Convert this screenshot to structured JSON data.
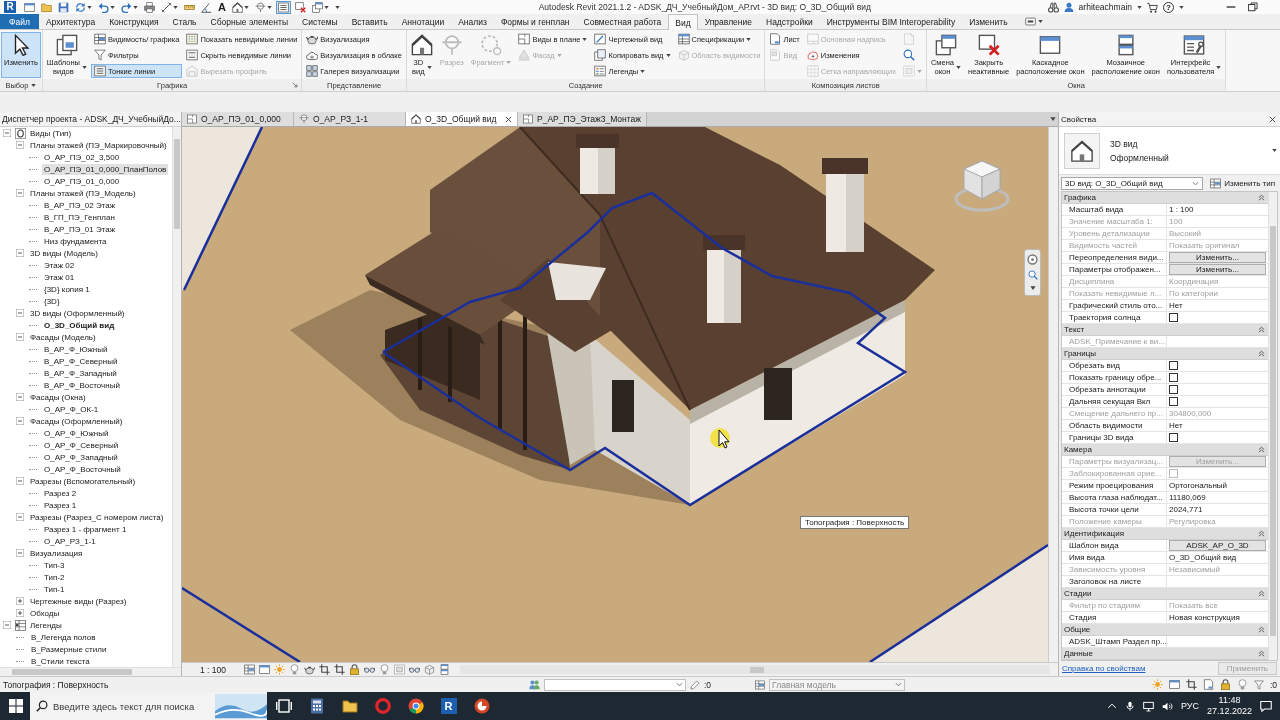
{
  "title_bar": {
    "logo": "R",
    "quick_access": [
      {
        "dropdown": false,
        "selected": false
      },
      {
        "dropdown": false,
        "selected": false
      },
      {
        "dropdown": false,
        "selected": false
      },
      {
        "dropdown": true,
        "selected": false
      },
      {
        "dropdown": true,
        "selected": false
      },
      {
        "dropdown": true,
        "selected": false
      },
      {
        "dropdown": false,
        "selected": false
      },
      {
        "dropdown": true,
        "selected": false
      },
      {
        "dropdown": false,
        "selected": false
      },
      {
        "dropdown": false,
        "selected": false
      },
      {
        "label": "A",
        "dropdown": false,
        "selected": false
      },
      {
        "dropdown": true,
        "selected": false
      },
      {
        "dropdown": true,
        "selected": false
      },
      {
        "dropdown": false,
        "selected": true
      },
      {
        "dropdown": false,
        "selected": false
      },
      {
        "dropdown": true,
        "selected": false
      },
      {
        "dropdown": true,
        "selected": false
      }
    ],
    "title": "Autodesk Revit 2021.1.2 - ADSK_ДЧ_УчебныйДом_АР.rvt - 3D вид: О_3D_Общий вид",
    "user": "arhiteachmain",
    "help": "?"
  },
  "ribbon": {
    "tabs": [
      {
        "label": "Файл",
        "kind": "file",
        "selected": false
      },
      {
        "label": "Архитектура",
        "kind": "tab",
        "selected": false
      },
      {
        "label": "Конструкция",
        "kind": "tab",
        "selected": false
      },
      {
        "label": "Сталь",
        "kind": "tab",
        "selected": false
      },
      {
        "label": "Сборные элементы",
        "kind": "tab",
        "selected": false
      },
      {
        "label": "Системы",
        "kind": "tab",
        "selected": false
      },
      {
        "label": "Вставить",
        "kind": "tab",
        "selected": false
      },
      {
        "label": "Аннотации",
        "kind": "tab",
        "selected": false
      },
      {
        "label": "Анализ",
        "kind": "tab",
        "selected": false
      },
      {
        "label": "Формы и генплан",
        "kind": "tab",
        "selected": false
      },
      {
        "label": "Совместная работа",
        "kind": "tab",
        "selected": false
      },
      {
        "label": "Вид",
        "kind": "tab",
        "selected": true
      },
      {
        "label": "Управление",
        "kind": "tab",
        "selected": false
      },
      {
        "label": "Надстройки",
        "kind": "tab",
        "selected": false
      },
      {
        "label": "Инструменты BIM Interoperability",
        "kind": "tab",
        "selected": false
      },
      {
        "label": "Изменить",
        "kind": "tab",
        "selected": false
      }
    ],
    "panels": [
      {
        "title": "Выбор",
        "menu": true,
        "launcher": false,
        "groups": [
          {
            "kind": "large",
            "buttons": [
              {
                "label": "Изменить",
                "selected": true,
                "disabled": false,
                "dropdown": false
              }
            ]
          }
        ]
      },
      {
        "title": "Графика",
        "menu": false,
        "launcher": true,
        "groups": [
          {
            "kind": "large",
            "buttons": [
              {
                "label": "Шаблоны\nвидов",
                "selected": false,
                "disabled": false,
                "dropdown": true
              }
            ]
          },
          {
            "kind": "column",
            "buttons": [
              {
                "label": "Видимость/ графика",
                "selected": false,
                "disabled": false,
                "dropdown": false
              },
              {
                "label": "Фильтры",
                "selected": false,
                "disabled": false,
                "dropdown": false
              },
              {
                "label": "Тонкие линии",
                "selected": true,
                "disabled": false,
                "dropdown": false
              }
            ]
          },
          {
            "kind": "column",
            "buttons": [
              {
                "label": "Показать невидимые линии",
                "selected": false,
                "disabled": false,
                "dropdown": false
              },
              {
                "label": "Скрыть невидимые линии",
                "selected": false,
                "disabled": false,
                "dropdown": false
              },
              {
                "label": "Вырезать профиль",
                "selected": false,
                "disabled": true,
                "dropdown": false
              }
            ]
          }
        ]
      },
      {
        "title": "Представление",
        "menu": false,
        "launcher": false,
        "groups": [
          {
            "kind": "column",
            "buttons": [
              {
                "label": "Визуализация",
                "selected": false,
                "disabled": false,
                "dropdown": false
              },
              {
                "label": "Визуализация в облаке",
                "selected": false,
                "disabled": false,
                "dropdown": false
              },
              {
                "label": "Галерея визуализации",
                "selected": false,
                "disabled": false,
                "dropdown": false
              }
            ]
          }
        ]
      },
      {
        "title": "Создание",
        "menu": false,
        "launcher": false,
        "groups": [
          {
            "kind": "large",
            "buttons": [
              {
                "label": "3D\nвид",
                "selected": false,
                "disabled": false,
                "dropdown": true
              },
              {
                "label": "Разрез",
                "selected": false,
                "disabled": true,
                "dropdown": false
              },
              {
                "label": "Фрагмент",
                "selected": false,
                "disabled": true,
                "dropdown": true
              }
            ]
          },
          {
            "kind": "column",
            "buttons": [
              {
                "label": "Виды в плане",
                "selected": false,
                "disabled": false,
                "dropdown": true
              },
              {
                "label": "Фасад",
                "selected": false,
                "disabled": true,
                "dropdown": true
              }
            ]
          },
          {
            "kind": "column",
            "buttons": [
              {
                "label": "Чертежный вид",
                "selected": false,
                "disabled": false,
                "dropdown": false
              },
              {
                "label": "Копировать вид",
                "selected": false,
                "disabled": false,
                "dropdown": true
              },
              {
                "label": "Легенды",
                "selected": false,
                "disabled": false,
                "dropdown": true
              }
            ]
          },
          {
            "kind": "column",
            "buttons": [
              {
                "label": "Спецификации",
                "selected": false,
                "disabled": false,
                "dropdown": true
              },
              {
                "label": "Область видимости",
                "selected": false,
                "disabled": true,
                "dropdown": false
              }
            ]
          }
        ]
      },
      {
        "title": "Композиция листов",
        "menu": false,
        "launcher": false,
        "groups": [
          {
            "kind": "column",
            "buttons": [
              {
                "label": "Лист",
                "selected": false,
                "disabled": false,
                "dropdown": false
              },
              {
                "label": "Вид",
                "selected": false,
                "disabled": true,
                "dropdown": false
              }
            ]
          },
          {
            "kind": "column",
            "buttons": [
              {
                "label": "Основная надпись",
                "selected": false,
                "disabled": true,
                "dropdown": false
              },
              {
                "label": "Изменения",
                "selected": false,
                "disabled": false,
                "dropdown": false
              },
              {
                "label": "Сетка направляющих",
                "selected": false,
                "disabled": true,
                "dropdown": false
              }
            ]
          },
          {
            "kind": "column",
            "buttons": [
              {
                "selected": false,
                "disabled": true,
                "dropdown": false
              },
              {
                "selected": false,
                "disabled": false,
                "dropdown": false
              },
              {
                "selected": false,
                "disabled": true,
                "dropdown": true
              }
            ]
          }
        ]
      },
      {
        "title": "Окна",
        "menu": false,
        "launcher": false,
        "groups": [
          {
            "kind": "large",
            "buttons": [
              {
                "label": "Смена\nокон",
                "selected": false,
                "disabled": false,
                "dropdown": true
              },
              {
                "label": "Закрыть\nнеактивные",
                "selected": false,
                "disabled": false,
                "dropdown": false
              },
              {
                "label": "Каскадное\nрасположение окон",
                "selected": false,
                "disabled": false,
                "dropdown": false
              },
              {
                "label": "Мозаичное\nрасположение окон",
                "selected": false,
                "disabled": false,
                "dropdown": false
              },
              {
                "label": "Интерфейс\nпользователя",
                "selected": false,
                "disabled": false,
                "dropdown": true
              }
            ]
          }
        ]
      }
    ]
  },
  "browser": {
    "title": "Диспетчер проекта - ADSK_ДЧ_УчебныйДо...",
    "tree": [
      {
        "label": "Виды (Тип)",
        "expanded": true,
        "children": [
          {
            "label": "Планы этажей (ПЭ_Маркировочный)",
            "expanded": true,
            "children": [
              {
                "label": "О_АР_ПЭ_02_3,500",
                "selected": false,
                "current": false
              },
              {
                "label": "О_АР_ПЭ_01_0,000_ПланПолов",
                "selected": true,
                "current": false
              },
              {
                "label": "О_АР_ПЭ_01_0,000",
                "selected": false,
                "current": false
              }
            ]
          },
          {
            "label": "Планы этажей (ПЭ_Модель)",
            "expanded": true,
            "children": [
              {
                "label": "В_АР_ПЭ_02 Этаж",
                "selected": false,
                "current": false
              },
              {
                "label": "В_ГП_ПЭ_Генплан",
                "selected": false,
                "current": false
              },
              {
                "label": "В_АР_ПЭ_01 Этаж",
                "selected": false,
                "current": false
              },
              {
                "label": "Низ фундамента",
                "selected": false,
                "current": false
              }
            ]
          },
          {
            "label": "3D виды (Модель)",
            "expanded": true,
            "children": [
              {
                "label": "Этаж 02",
                "selected": false,
                "current": false
              },
              {
                "label": "Этаж 01",
                "selected": false,
                "current": false
              },
              {
                "label": "{3D} копия 1",
                "selected": false,
                "current": false
              },
              {
                "label": "{3D}",
                "selected": false,
                "current": false
              }
            ]
          },
          {
            "label": "3D виды (Оформленный)",
            "expanded": true,
            "children": [
              {
                "label": "О_3D_Общий вид",
                "selected": false,
                "current": true
              }
            ]
          },
          {
            "label": "Фасады (Модель)",
            "expanded": true,
            "children": [
              {
                "label": "В_АР_Ф_Южный",
                "selected": false,
                "current": false
              },
              {
                "label": "В_АР_Ф_Северный",
                "selected": false,
                "current": false
              },
              {
                "label": "В_АР_Ф_Западный",
                "selected": false,
                "current": false
              },
              {
                "label": "В_АР_Ф_Восточный",
                "selected": false,
                "current": false
              }
            ]
          },
          {
            "label": "Фасады (Окна)",
            "expanded": true,
            "children": [
              {
                "label": "О_АР_Ф_ОК-1",
                "selected": false,
                "current": false
              }
            ]
          },
          {
            "label": "Фасады (Оформленный)",
            "expanded": true,
            "children": [
              {
                "label": "О_АР_Ф_Южный",
                "selected": false,
                "current": false
              },
              {
                "label": "О_АР_Ф_Северный",
                "selected": false,
                "current": false
              },
              {
                "label": "О_АР_Ф_Западный",
                "selected": false,
                "current": false
              },
              {
                "label": "О_АР_Ф_Восточный",
                "selected": false,
                "current": false
              }
            ]
          },
          {
            "label": "Разрезы (Вспомогательный)",
            "expanded": true,
            "children": [
              {
                "label": "Разрез 2",
                "selected": false,
                "current": false
              },
              {
                "label": "Разрез 1",
                "selected": false,
                "current": false
              }
            ]
          },
          {
            "label": "Разрезы (Разрез_С номером листа)",
            "expanded": true,
            "children": [
              {
                "label": "Разрез 1 - фрагмент 1",
                "selected": false,
                "current": false
              },
              {
                "label": "О_АР_РЗ_1-1",
                "selected": false,
                "current": false
              }
            ]
          },
          {
            "label": "Визуализация",
            "expanded": true,
            "children": [
              {
                "label": "Тип-3",
                "selected": false,
                "current": false
              },
              {
                "label": "Тип-2",
                "selected": false,
                "current": false
              },
              {
                "label": "Тип-1",
                "selected": false,
                "current": false
              }
            ]
          },
          {
            "label": "Чертежные виды (Разрез)",
            "expanded": false
          },
          {
            "label": "Обходы",
            "expanded": false
          }
        ]
      },
      {
        "label": "Легенды",
        "expanded": true,
        "children": [
          {
            "label": "В_Легенда полов",
            "selected": false,
            "current": false
          },
          {
            "label": "В_Размерные стили",
            "selected": false,
            "current": false
          },
          {
            "label": "В_Стили текста",
            "selected": false,
            "current": false
          }
        ]
      }
    ]
  },
  "view_tabs": [
    {
      "label": "О_АР_ПЭ_01_0,000",
      "selected": false
    },
    {
      "label": "О_АР_РЗ_1-1",
      "selected": false
    },
    {
      "label": "О_3D_Общий вид",
      "selected": true
    },
    {
      "label": "Р_АР_ПЭ_Этаж3_Монтаж",
      "selected": false
    }
  ],
  "viewport": {
    "tooltip": "Топография : Поверхность"
  },
  "view_control": {
    "scale": "1 : 100"
  },
  "properties": {
    "title": "Свойства",
    "type_family": "3D вид",
    "type_name": "Оформленный",
    "instance_selector": "3D вид: О_3D_Общий вид",
    "edit_type": "Изменить тип",
    "sections": [
      {
        "title": "Графика",
        "rows": [
          {
            "label": "Масштаб вида",
            "kind": "text",
            "value": "1 : 100",
            "disabled": false
          },
          {
            "label": "Значение масштаба 1:",
            "kind": "text",
            "value": "100",
            "disabled": true
          },
          {
            "label": "Уровень детализации",
            "kind": "text",
            "value": "Высокий",
            "disabled": true
          },
          {
            "label": "Видимость частей",
            "kind": "text",
            "value": "Показать оригинал",
            "disabled": true
          },
          {
            "label": "Переопределения види...",
            "kind": "button",
            "value": "Изменить...",
            "disabled": false
          },
          {
            "label": "Параметры отображен...",
            "kind": "button",
            "value": "Изменить...",
            "disabled": false
          },
          {
            "label": "Дисциплина",
            "kind": "text",
            "value": "Координация",
            "disabled": true
          },
          {
            "label": "Показать невидимые л...",
            "kind": "text",
            "value": "По категории",
            "disabled": true
          },
          {
            "label": "Графический стиль ото...",
            "kind": "text",
            "value": "Нет",
            "disabled": false
          },
          {
            "label": "Траектория солнца",
            "kind": "checkbox",
            "checked": false,
            "disabled": false
          }
        ]
      },
      {
        "title": "Текст",
        "rows": [
          {
            "label": "ADSK_Примечание к ви...",
            "kind": "text",
            "disabled": true
          }
        ]
      },
      {
        "title": "Границы",
        "rows": [
          {
            "label": "Обрезать вид",
            "kind": "checkbox",
            "checked": false,
            "disabled": false
          },
          {
            "label": "Показать границу обре...",
            "kind": "checkbox",
            "checked": false,
            "disabled": false
          },
          {
            "label": "Обрезать аннотации",
            "kind": "checkbox",
            "checked": false,
            "disabled": false
          },
          {
            "label": "Дальняя секущая Вкл",
            "kind": "checkbox",
            "checked": false,
            "disabled": false
          },
          {
            "label": "Смещение дальнего пр...",
            "kind": "text",
            "value": "304800,000",
            "disabled": true
          },
          {
            "label": "Область видимости",
            "kind": "text",
            "value": "Нет",
            "disabled": false
          },
          {
            "label": "Границы 3D вида",
            "kind": "checkbox",
            "checked": false,
            "disabled": false
          }
        ]
      },
      {
        "title": "Камера",
        "rows": [
          {
            "label": "Параметры визуализац...",
            "kind": "button",
            "value": "Изменить...",
            "disabled": true
          },
          {
            "label": "Заблокированная орие...",
            "kind": "checkbox",
            "checked": false,
            "disabled": true
          },
          {
            "label": "Режим проецирования",
            "kind": "text",
            "value": "Ортогональный",
            "disabled": false
          },
          {
            "label": "Высота глаза наблюдат...",
            "kind": "text",
            "value": "11180,069",
            "disabled": false
          },
          {
            "label": "Высота точки цели",
            "kind": "text",
            "value": "2024,771",
            "disabled": false
          },
          {
            "label": "Положение камеры",
            "kind": "text",
            "value": "Регулировка",
            "disabled": true
          }
        ]
      },
      {
        "title": "Идентификация",
        "rows": [
          {
            "label": "Шаблон вида",
            "kind": "button",
            "value": "ADSK_АР_О_3D",
            "disabled": false
          },
          {
            "label": "Имя вида",
            "kind": "text",
            "value": "О_3D_Общий вид",
            "disabled": false
          },
          {
            "label": "Зависимость уровня",
            "kind": "text",
            "value": "Независимый",
            "disabled": true
          },
          {
            "label": "Заголовок на листе",
            "kind": "text",
            "disabled": false
          }
        ]
      },
      {
        "title": "Стадии",
        "rows": [
          {
            "label": "Фильтр по стадиям",
            "kind": "text",
            "value": "Показать все",
            "disabled": true
          },
          {
            "label": "Стадия",
            "kind": "text",
            "value": "Новая конструкция",
            "disabled": false
          }
        ]
      },
      {
        "title": "Общие",
        "rows": [
          {
            "label": "ADSK_Штамп Раздел пр...",
            "kind": "text",
            "disabled": false
          }
        ]
      },
      {
        "title": "Данные"
      }
    ],
    "help_link": "Справка по свойствам",
    "apply": {
      "label": "Применить",
      "disabled": true
    }
  },
  "status_bar": {
    "text": "Топография : Поверхность",
    "editable_count": ":0",
    "model": "Главная модель",
    "selection_count": ":0"
  },
  "taskbar": {
    "search_placeholder": "Введите здесь текст для поиска",
    "app_letter": "R",
    "language": "РУС",
    "time": "11:48",
    "date": "27.12.2022"
  }
}
